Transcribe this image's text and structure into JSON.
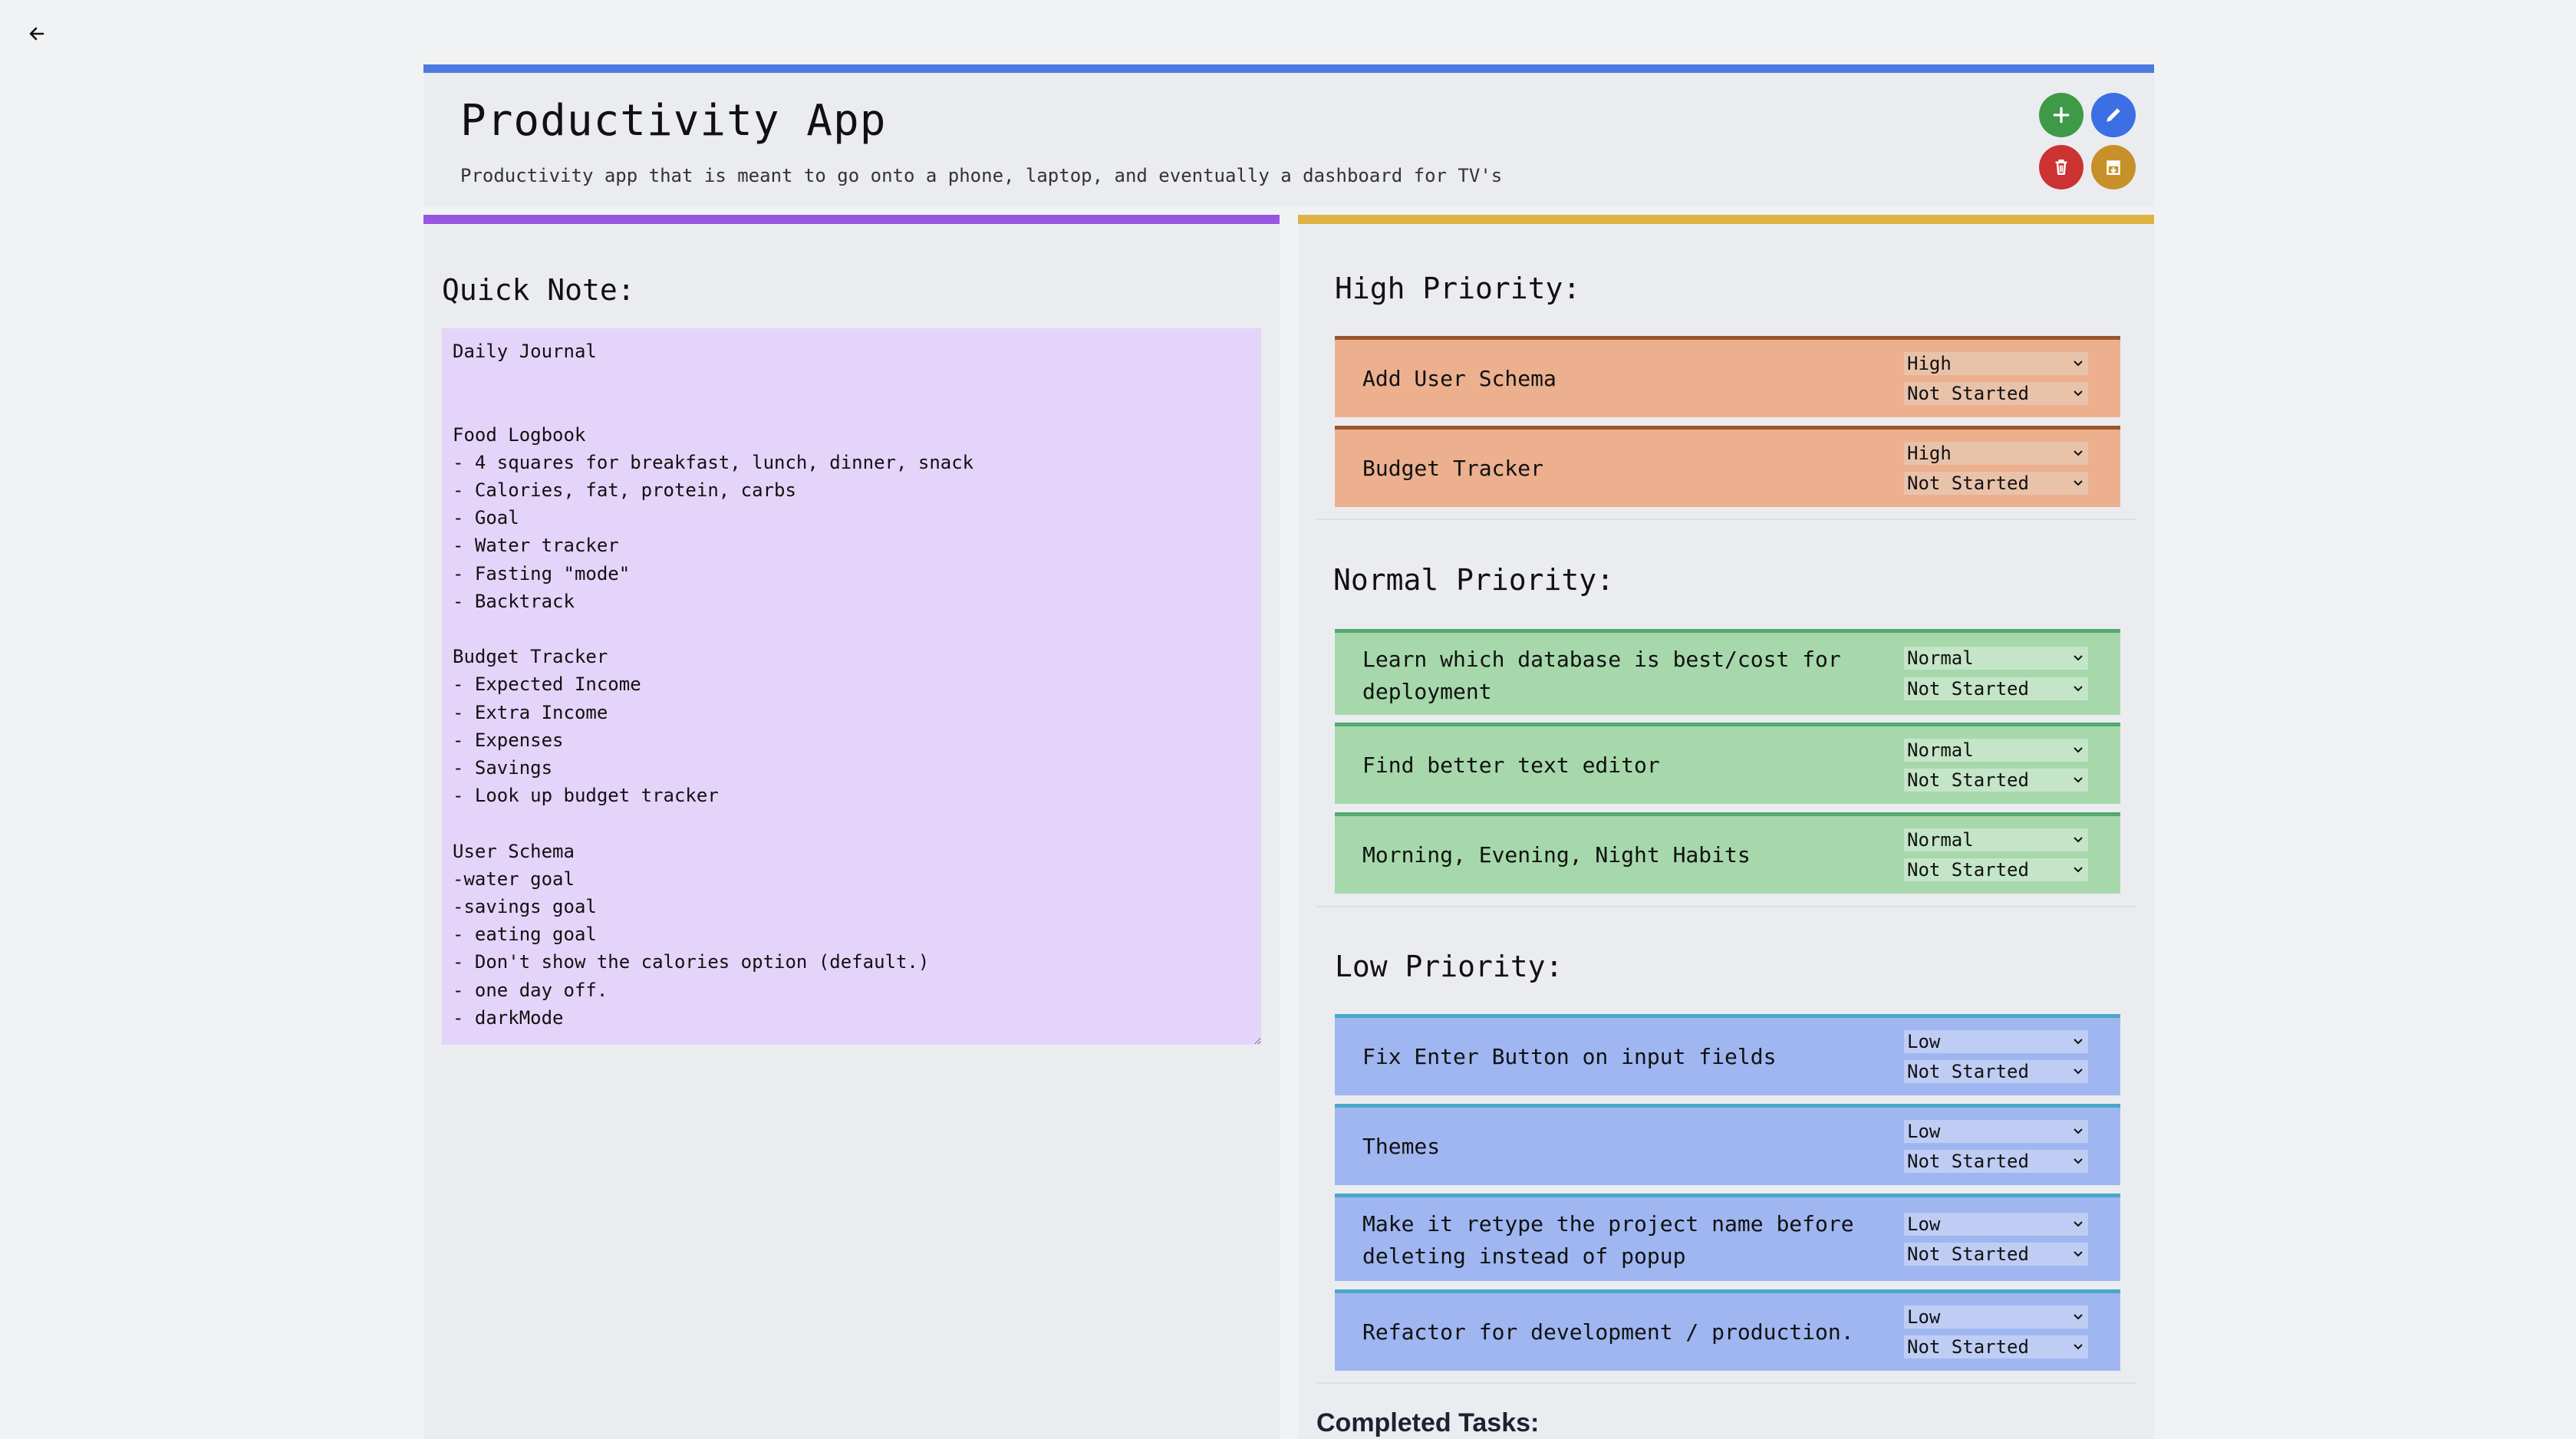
{
  "header": {
    "title": "Productivity App",
    "subtitle": "Productivity app that is meant to go onto a phone, laptop, and eventually a dashboard for TV's",
    "buttons": [
      {
        "name": "add-button",
        "icon": "plus-icon",
        "color": "#3e9a47"
      },
      {
        "name": "edit-button",
        "icon": "pencil-icon",
        "color": "#3d6fe4"
      },
      {
        "name": "delete-button",
        "icon": "trash-icon",
        "color": "#cc3232"
      },
      {
        "name": "archive-button",
        "icon": "archive-icon",
        "color": "#c79028"
      }
    ]
  },
  "colors": {
    "header_accent": "#4b7be0",
    "note_accent": "#9656e0",
    "tasks_accent": "#dfb245",
    "note_background": "#e4d4fa",
    "high": "#ecb08f",
    "normal": "#a6d8ab",
    "low": "#9fb6f1"
  },
  "quick_note": {
    "heading": "Quick Note:",
    "text": "Daily Journal\n\n\nFood Logbook\n- 4 squares for breakfast, lunch, dinner, snack\n- Calories, fat, protein, carbs\n- Goal\n- Water tracker\n- Fasting \"mode\"\n- Backtrack\n\nBudget Tracker\n- Expected Income\n- Extra Income\n- Expenses\n- Savings\n- Look up budget tracker\n\nUser Schema\n-water goal\n-savings goal\n- eating goal\n- Don't show the calories option (default.)\n- one day off.\n- darkMode\n..."
  },
  "high_priority": {
    "heading": "High Priority:",
    "tasks": [
      {
        "label": "Add User Schema",
        "priority": "High",
        "status": "Not Started"
      },
      {
        "label": "Budget Tracker",
        "priority": "High",
        "status": "Not Started"
      }
    ]
  },
  "normal_priority": {
    "heading": "Normal Priority:",
    "tasks": [
      {
        "label": "Learn which database is best/cost for deployment",
        "priority": "Normal",
        "status": "Not Started"
      },
      {
        "label": "Find better text editor",
        "priority": "Normal",
        "status": "Not Started"
      },
      {
        "label": "Morning, Evening, Night Habits",
        "priority": "Normal",
        "status": "Not Started"
      }
    ]
  },
  "low_priority": {
    "heading": "Low Priority:",
    "tasks": [
      {
        "label": "Fix Enter Button on input fields",
        "priority": "Low",
        "status": "Not Started"
      },
      {
        "label": "Themes",
        "priority": "Low",
        "status": "Not Started"
      },
      {
        "label": "Make it retype the project name before deleting instead of popup",
        "priority": "Low",
        "status": "Not Started"
      },
      {
        "label": "Refactor for development / production.",
        "priority": "Low",
        "status": "Not Started"
      }
    ]
  },
  "completed": {
    "heading": "Completed Tasks:"
  }
}
